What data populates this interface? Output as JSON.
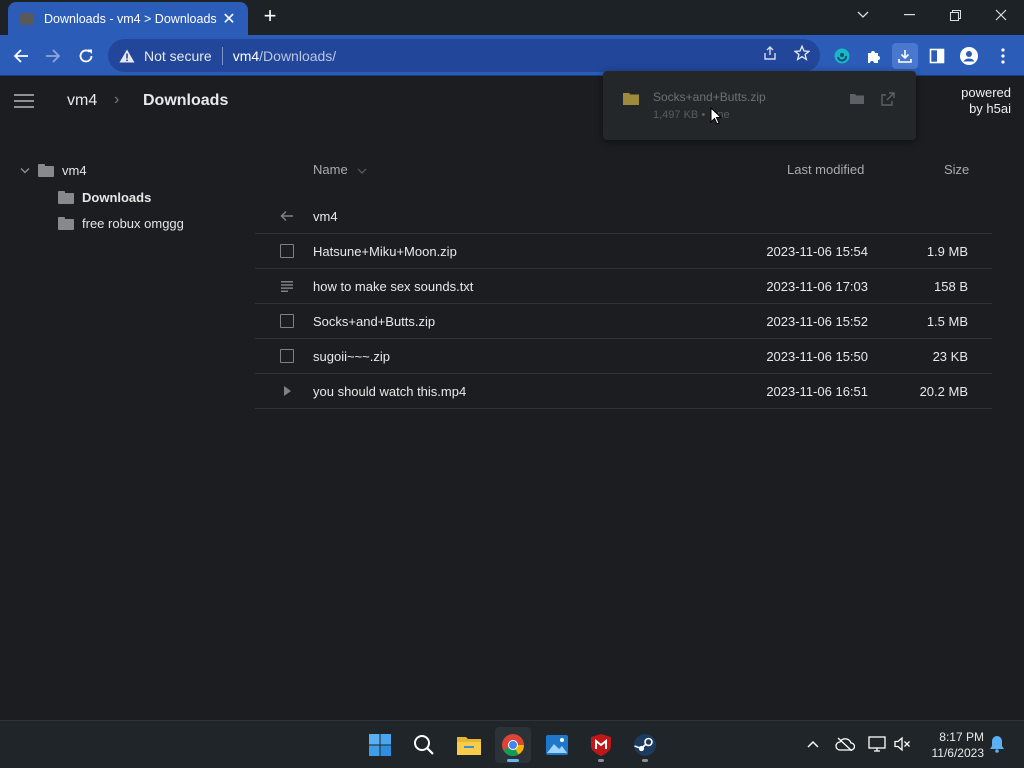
{
  "browser": {
    "tab_title": "Downloads - vm4 > Downloads",
    "tab_close": "✕",
    "new_tab": "+",
    "security_label": "Not secure",
    "url_host": "vm4",
    "url_path": "/Downloads/",
    "accent": "#2b5cb8"
  },
  "header": {
    "crumbs": [
      "vm4",
      "Downloads"
    ],
    "powered_line1": "powered",
    "powered_line2": "by h5ai"
  },
  "tree": {
    "root": "vm4",
    "items": [
      "Downloads",
      "free robux omggg"
    ]
  },
  "table": {
    "columns": {
      "name": "Name",
      "modified": "Last modified",
      "size": "Size"
    },
    "parent": "vm4",
    "rows": [
      {
        "name": "Hatsune+Miku+Moon.zip",
        "date": "2023-11-06 15:54",
        "size": "1.9 MB",
        "icon": "file-icon"
      },
      {
        "name": "how to make sex sounds.txt",
        "date": "2023-11-06 17:03",
        "size": "158 B",
        "icon": "text-file-icon"
      },
      {
        "name": "Socks+and+Butts.zip",
        "date": "2023-11-06 15:52",
        "size": "1.5 MB",
        "icon": "file-icon"
      },
      {
        "name": "sugoii~~~.zip",
        "date": "2023-11-06 15:50",
        "size": "23 KB",
        "icon": "file-icon"
      },
      {
        "name": "you should watch this.mp4",
        "date": "2023-11-06 16:51",
        "size": "20.2 MB",
        "icon": "video-file-icon"
      }
    ]
  },
  "download_popup": {
    "filename": "Socks+and+Butts.zip",
    "meta_left": "1,497 KB •",
    "meta_right": "ne"
  },
  "taskbar": {
    "time": "8:17 PM",
    "date": "11/6/2023"
  }
}
